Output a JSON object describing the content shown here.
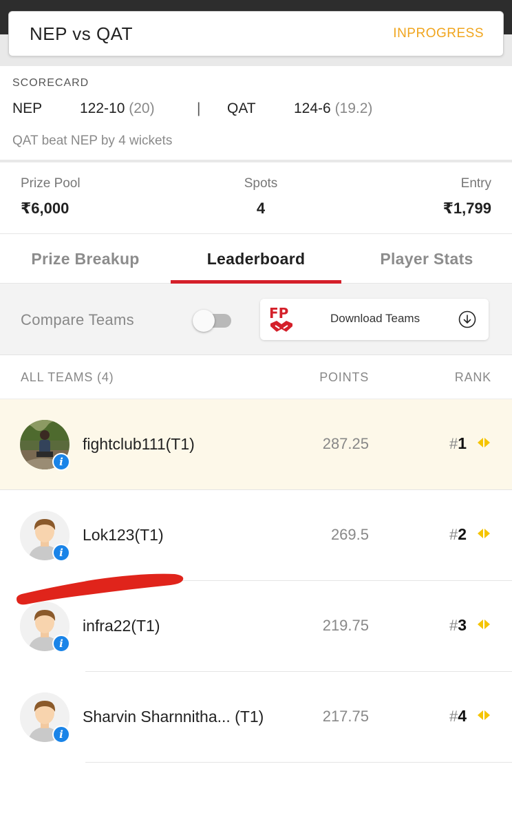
{
  "match": {
    "title": "NEP vs QAT",
    "status": "INPROGRESS",
    "status_color": "#f0a51e"
  },
  "scorecard": {
    "label": "SCORECARD",
    "team1": {
      "name": "NEP",
      "score": "122-10",
      "overs": "(20)"
    },
    "separator": "|",
    "team2": {
      "name": "QAT",
      "score": "124-6",
      "overs": "(19.2)"
    },
    "result": "QAT beat NEP by 4 wickets"
  },
  "contest": {
    "prize_pool_label": "Prize Pool",
    "prize_pool_value": "₹6,000",
    "spots_label": "Spots",
    "spots_value": "4",
    "entry_label": "Entry",
    "entry_value": "₹1,799"
  },
  "tabs": [
    {
      "label": "Prize Breakup",
      "active": false
    },
    {
      "label": "Leaderboard",
      "active": true
    },
    {
      "label": "Player Stats",
      "active": false
    }
  ],
  "compare": {
    "label": "Compare Teams",
    "toggle_on": false,
    "download_label": "Download Teams",
    "logo_text": "FP",
    "download_icon": "download-circle-icon"
  },
  "leaderboard": {
    "header_teams": "ALL TEAMS (4)",
    "header_points": "POINTS",
    "header_rank": "RANK",
    "rank_prefix": "#",
    "rows": [
      {
        "name": "fightclub111(T1)",
        "points": "287.25",
        "rank": "1",
        "avatar": "photo-avatar",
        "highlight": true
      },
      {
        "name": "Lok123(T1)",
        "points": "269.5",
        "rank": "2",
        "avatar": "default-avatar",
        "highlight": false
      },
      {
        "name": "infra22(T1)",
        "points": "219.75",
        "rank": "3",
        "avatar": "default-avatar",
        "highlight": false
      },
      {
        "name": "Sharvin Sharnnitha... (T1)",
        "points": "217.75",
        "rank": "4",
        "avatar": "default-avatar",
        "highlight": false
      }
    ]
  },
  "colors": {
    "accent_red": "#d4202a",
    "info_blue": "#1a84e8",
    "rank_arrow_yellow": "#f5c400",
    "highlight_row": "#fdf8e9",
    "scribble_red": "#e0241b"
  }
}
